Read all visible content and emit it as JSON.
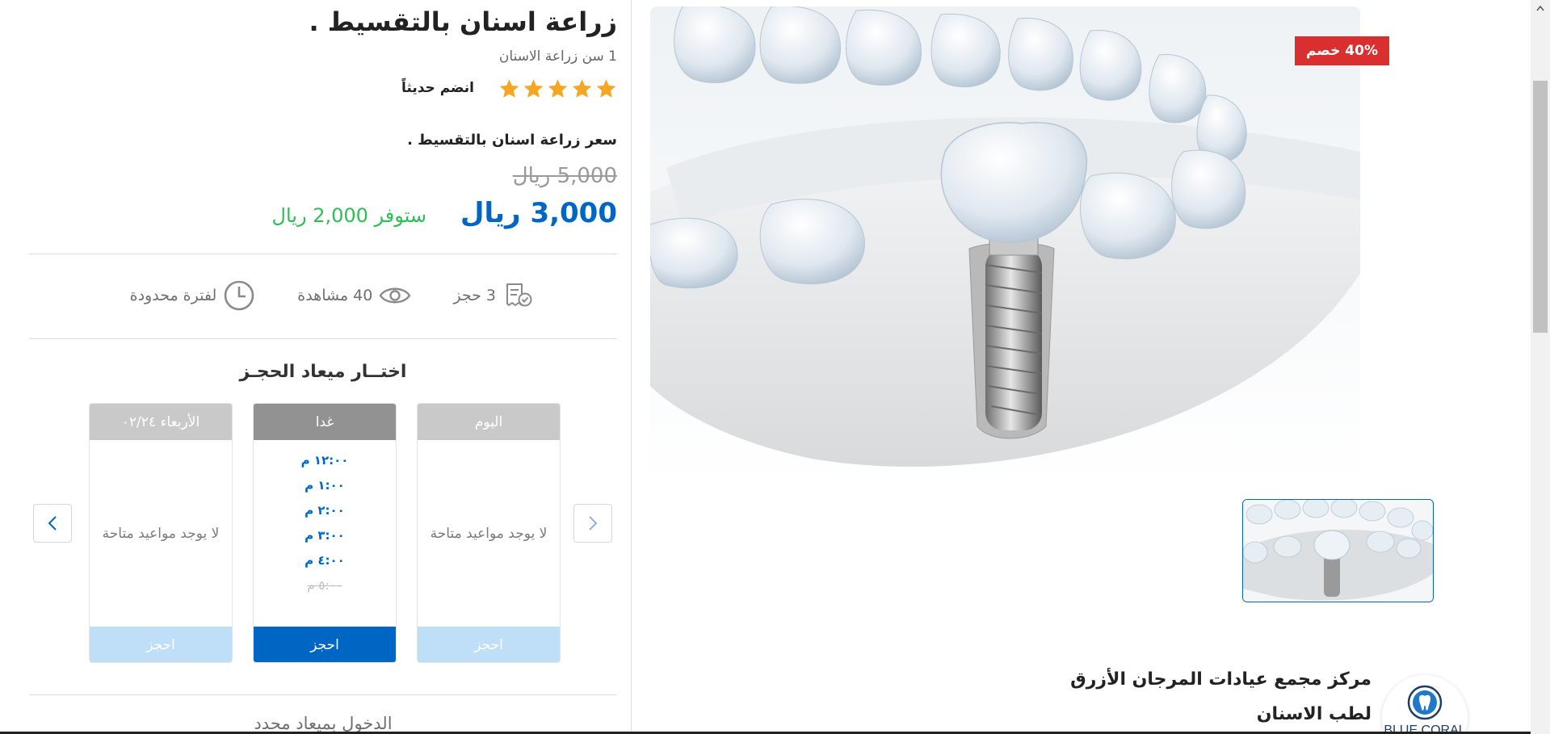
{
  "product": {
    "title": "زراعة اسنان بالتقسيط .",
    "subtitle": "1 سن زراعة الاسنان",
    "rating_stars": 5,
    "rating_note": "انضم حديثاً",
    "price_heading": "سعر زراعة اسنان بالتقسيط .",
    "old_price": "5,000 ريال",
    "new_price": "3,000 ريال",
    "savings": "ستوفر 2,000 ريال",
    "discount_badge": "40% خصم"
  },
  "stats": {
    "bookings": "3 حجز",
    "views": "40 مشاهدة",
    "limited": "لفترة محدودة"
  },
  "booking": {
    "heading": "اختــار ميعاد الحجـز",
    "days": [
      {
        "label": "اليوم",
        "empty_text": "لا يوجد مواعيد متاحة",
        "button": "احجز"
      },
      {
        "label": "غدا",
        "slots": [
          "١٢:٠٠ م",
          "١:٠٠ م",
          "٢:٠٠ م",
          "٣:٠٠ م",
          "٤:٠٠ م"
        ],
        "disabled_slot": "٥:٠٠ م",
        "button": "احجز"
      },
      {
        "label": "الأربعاء ٠٢/٢٤",
        "empty_text": "لا يوجد مواعيد متاحة",
        "button": "احجز"
      }
    ],
    "footer_text": "الدخول بميعاد محدد"
  },
  "clinic": {
    "name": "مركز مجمع عيادات المرجان الأزرق لطب الاسنان",
    "logo_text": "BLUE CORAL"
  },
  "colors": {
    "accent": "#0066c4",
    "savings": "#2cbf55",
    "badge": "#d92f2f",
    "star": "#f5a623"
  },
  "icons": {
    "bookings": "receipt-check-icon",
    "views": "eye-icon",
    "limited": "clock-icon",
    "next": "chevron-right-icon",
    "prev": "chevron-left-icon"
  }
}
